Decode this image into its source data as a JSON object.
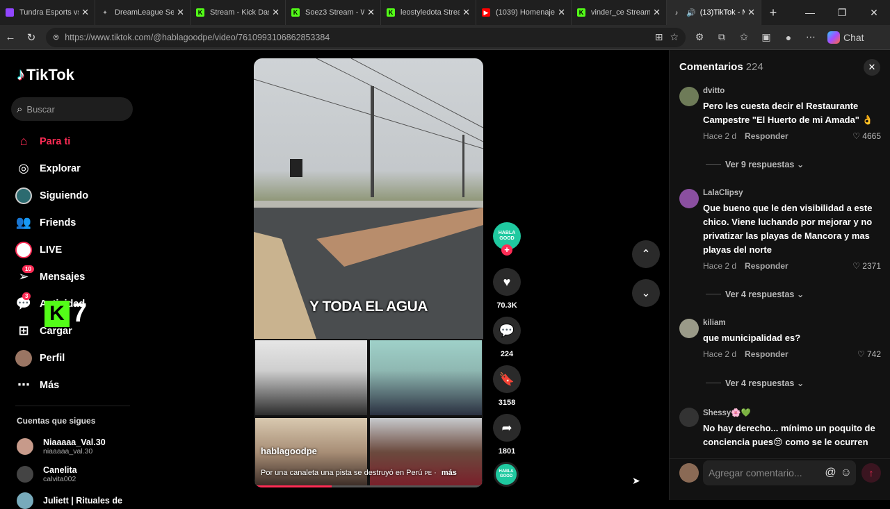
{
  "browser": {
    "tabs": [
      {
        "title": "Tundra Esports vs Te",
        "icon": "twitch-icon",
        "color": "#9146ff"
      },
      {
        "title": "DreamLeague Seaso",
        "icon": "dreamleague-icon",
        "color": "#8a8a8a"
      },
      {
        "title": "Stream - Kick Dashb",
        "icon": "kick-icon",
        "color": "#53fc18"
      },
      {
        "title": "Soez3 Stream - Wat",
        "icon": "kick-icon",
        "color": "#53fc18"
      },
      {
        "title": "leostyledota Stream",
        "icon": "kick-icon",
        "color": "#53fc18"
      },
      {
        "title": "(1039) Homenaje a",
        "icon": "youtube-icon",
        "color": "#ff0000"
      },
      {
        "title": "vinder_ce Stream - W",
        "icon": "kick-icon",
        "color": "#53fc18"
      },
      {
        "title": "(13)TikTok - Ma",
        "icon": "tiktok-icon",
        "color": "#ffffff",
        "active": true
      }
    ],
    "url": "https://www.tiktok.com/@hablagoodpe/video/7610993106862853384",
    "chat_label": "Chat"
  },
  "sidebar": {
    "logo": "TikTok",
    "search_placeholder": "Buscar",
    "items": [
      {
        "label": "Para ti",
        "icon": "home-icon"
      },
      {
        "label": "Explorar",
        "icon": "compass-icon"
      },
      {
        "label": "Siguiendo",
        "icon": "following-icon"
      },
      {
        "label": "Friends",
        "icon": "friends-icon"
      },
      {
        "label": "LIVE",
        "icon": "live-icon"
      },
      {
        "label": "Mensajes",
        "icon": "messages-icon",
        "badge": "10"
      },
      {
        "label": "Actividad",
        "icon": "activity-icon",
        "badge": "3"
      },
      {
        "label": "Cargar",
        "icon": "upload-icon"
      },
      {
        "label": "Perfil",
        "icon": "profile-icon"
      },
      {
        "label": "Más",
        "icon": "more-icon"
      }
    ],
    "overlay_text": "7",
    "following_title": "Cuentas que sigues",
    "following": [
      {
        "name": "Niaaaaa_Val.30",
        "username": "niaaaaa_val.30"
      },
      {
        "name": "Canelita",
        "username": "calvita002"
      },
      {
        "name": "Juliett | Rituales de",
        "username": ""
      }
    ]
  },
  "video": {
    "caption": "Y TODA EL AGUA",
    "author": "hablagoodpe",
    "description": "Por una canaleta una pista se destruyó en Perú",
    "country_tag": "PE",
    "more_label": "más",
    "progress": 0.34
  },
  "actions": {
    "creator_label": "HABLA GOOD",
    "likes": "70.3K",
    "comments": "224",
    "saves": "3158",
    "shares": "1801"
  },
  "comments": {
    "title": "Comentarios",
    "count": "224",
    "items": [
      {
        "user": "dvitto",
        "text": "Pero les cuesta decir el Restaurante Campestre \"El Huerto de mi Amada\" 👌",
        "time": "Hace 2 d",
        "reply": "Responder",
        "likes": "4665",
        "replies": "Ver 9 respuestas"
      },
      {
        "user": "LalaClipsy",
        "text": "Que bueno que le den visibilidad a este chico. Viene luchando por mejorar y no privatizar las playas de Mancora y mas playas del norte",
        "time": "Hace 2 d",
        "reply": "Responder",
        "likes": "2371",
        "replies": "Ver 4 respuestas"
      },
      {
        "user": "kiliam",
        "text": "que municipalidad es?",
        "time": "Hace 2 d",
        "reply": "Responder",
        "likes": "742",
        "replies": "Ver 4 respuestas"
      },
      {
        "user": "Shessy🌸💚",
        "text": "No hay derecho... mínimo un poquito de conciencia pues😒 como se le ocurren",
        "time": "",
        "reply": "",
        "likes": "",
        "replies": ""
      }
    ],
    "input_placeholder": "Agregar comentario..."
  }
}
